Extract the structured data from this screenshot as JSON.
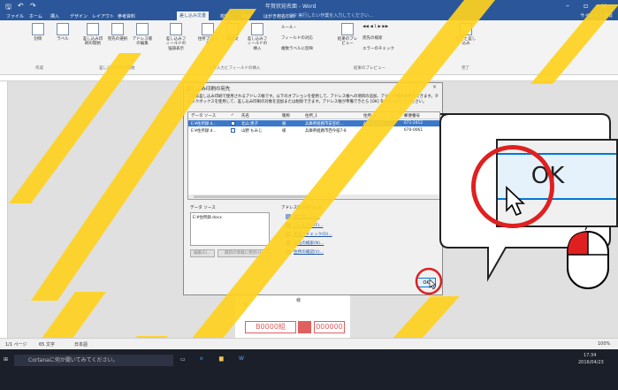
{
  "titlebar": {
    "title": "年賀状宛名面 - Word",
    "qa_save": "🖫",
    "qa_undo": "↶",
    "qa_redo": "↷"
  },
  "tabs": {
    "items": [
      "ファイル",
      "ホーム",
      "挿入",
      "デザイン",
      "レイアウト",
      "参考資料",
      "差し込み文書",
      "校閲",
      "表示",
      "はがき宛名印刷"
    ],
    "tell": "♀ 実行したい作業を入力してください…",
    "signin": "サインイン  共有"
  },
  "ribbon": {
    "buttons": [
      "封筒",
      "ラベル",
      "差し込み印刷の開始",
      "宛先の選択",
      "アドレス帳の編集",
      "差し込みフィールドの強調表示",
      "住所ブロック",
      "挨拶文",
      "差し込みフィールドの挿入",
      "結果のプレビュー",
      "完了と差し込み"
    ],
    "small": [
      "ルール・",
      "フィールドの対応",
      "複数ラベルに反映",
      "宛先の検索",
      "エラーのチェック"
    ],
    "groups": [
      "作成",
      "差し込み印刷の開始",
      "文章入力とフィールドの挿入",
      "結果のプレビュー",
      "完了"
    ]
  },
  "dialog": {
    "title": "差し込み印刷の宛先",
    "help": "?",
    "close": "×",
    "description": "これは差し込み印刷で使用されるアドレス帳です。以下のオプションを使用して、アドレス帳への項目の追加、アドレス帳の変更ができます。チェックボックスを使用して、差し込み印刷の対象を追加または削除できます。アドレス帳が準備できたら [OK] をクリックしてください。",
    "columns": [
      "データ ソース",
      "✓",
      "氏名",
      "敬称",
      "住所_1",
      "住所_2",
      "郵便番号"
    ],
    "rows": [
      {
        "source": "E:¥住所録.d...",
        "name": "北山 恵子",
        "title": "様",
        "addr1": "兵庫県姫路市安室町...",
        "addr2": "ABCビル9F",
        "zip": "671-2412",
        "selected": true
      },
      {
        "source": "E:¥住所録.d...",
        "name": "山野 もみじ",
        "title": "様",
        "addr1": "兵庫県姫路市西今宿7-8",
        "addr2": "",
        "zip": "670-0061",
        "selected": false
      }
    ],
    "source_label": "データ ソース",
    "source_value": "E:¥住所録.docx",
    "edit_button": "編集(E)...",
    "refresh_button": "最新の情報に更新(H)",
    "refine_label": "アドレス帳の絞り込み",
    "links": [
      "並べ替え(S)...",
      "フィルター(F)...",
      "重複のチェック(D)...",
      "宛先の検索(N)...",
      "住所の確認(V)..."
    ],
    "ok": "OK"
  },
  "zoom": {
    "ok": "OK"
  },
  "postcard": {
    "kai": "会",
    "sama": "様",
    "left_code": "B0000組",
    "right_code": "000000"
  },
  "statusbar": {
    "page": "1/1 ページ",
    "words": "65 文字",
    "lang": "日本語",
    "zoom": "100%"
  },
  "taskbar": {
    "search": "Cortanaに何か聞いてみてください。",
    "time": "17:34",
    "date": "2016/04/23"
  },
  "colors": {
    "word_blue": "#2b579a",
    "highlight": "#ffd21f",
    "callout_red": "#e02020"
  }
}
